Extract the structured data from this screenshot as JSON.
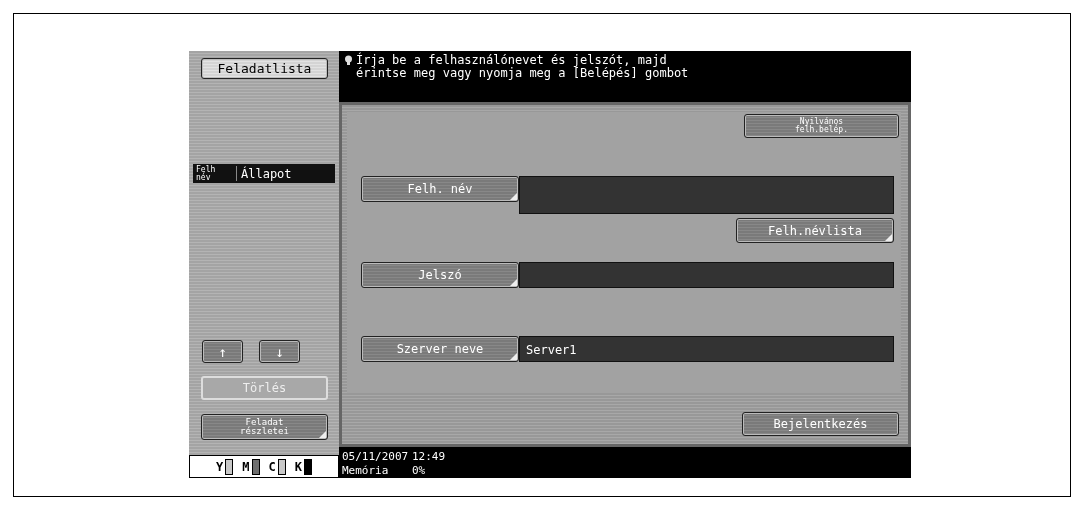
{
  "sidebar": {
    "job_list_button": "Feladatlista",
    "list_columns": [
      "Felh\nnév",
      "Állapot"
    ],
    "scroll_buttons": [
      {
        "symbol": "↑"
      },
      {
        "symbol": "↓"
      }
    ],
    "delete_button": {
      "label": "Törlés",
      "disabled": true
    },
    "details_button": "Feladat\nrészletei",
    "toner": [
      {
        "label": "Y",
        "color": "#c8c8c8"
      },
      {
        "label": "M",
        "color": "#6e6e6e"
      },
      {
        "label": "C",
        "color": "#c8c8c8"
      },
      {
        "label": "K",
        "color": "#000000"
      }
    ]
  },
  "message": "Írja be a felhasználónevet és jelszót, majd\nérintse meg vagy nyomja meg a [Belépés] gombot",
  "public_login_button": "Nyilvános\nfelh.belép.",
  "form": [
    {
      "label": "Felh. név",
      "tall": true,
      "extra_button": "Felh.névlista"
    },
    {
      "label": "Jelszó",
      "tall": false
    },
    {
      "label": "Szerver neve",
      "value": "Server1",
      "tall": false
    }
  ],
  "login_button": "Bejelentkezés",
  "status_bar": {
    "date": "05/11/2007",
    "time": "12:49",
    "memory_label": "Memória",
    "memory_value": "0%"
  }
}
